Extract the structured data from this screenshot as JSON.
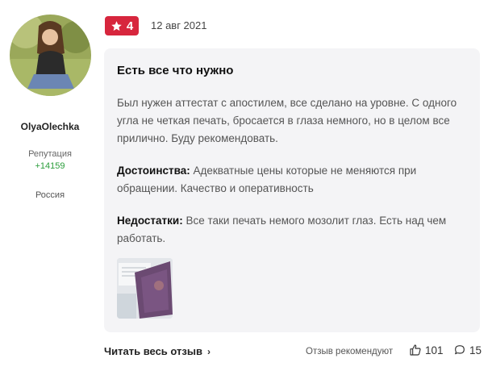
{
  "user": {
    "name": "OlyaOlechka",
    "reputation_label": "Репутация",
    "reputation_value": "+14159",
    "country": "Россия"
  },
  "review": {
    "rating": "4",
    "date": "12 авг 2021",
    "title": "Есть все что нужно",
    "body": "Был нужен аттестат с апостилем, все сделано на уровне. С одного угла не четкая печать, бросается в глаза немного, но в целом все прилично. Буду рекомендовать.",
    "pros_label": "Достоинства:",
    "pros_text": " Адекватные цены которые не меняются при обращении. Качество и оперативность",
    "cons_label": "Недостатки:",
    "cons_text": " Все таки печать немого мозолит глаз. Есть над чем работать."
  },
  "footer": {
    "read_full": "Читать весь отзыв",
    "recommend": "Отзыв рекомендуют",
    "likes": "101",
    "comments": "15"
  },
  "colors": {
    "accent": "#d7263d",
    "reputation": "#2a9d3a",
    "card_bg": "#f4f4f6"
  }
}
